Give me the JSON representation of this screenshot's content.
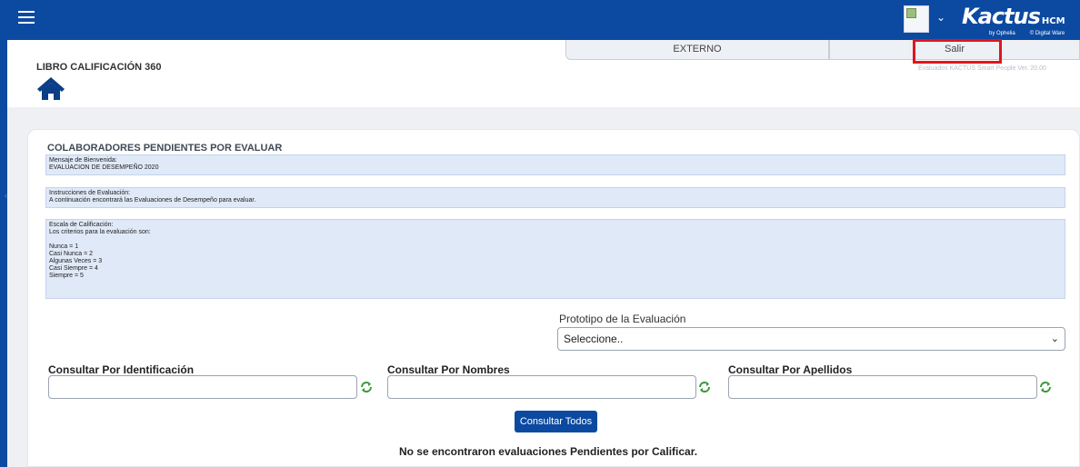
{
  "header": {
    "logo_main": "Kactus",
    "logo_suffix": "HCM",
    "logo_by": "by Ophelia",
    "logo_brand": "© Digital Ware",
    "brand_color": "#0b4aa0"
  },
  "tabs": [
    {
      "label": "EXTERNO"
    },
    {
      "label": "Salir"
    }
  ],
  "version": "Evaluados KACTUS Smart People Ver. 20.00",
  "page": {
    "title": "LIBRO CALIFICACIÓN 360"
  },
  "section": {
    "title": "COLABORADORES PENDIENTES POR EVALUAR",
    "welcome": {
      "label": "Mensaje de Bienvenida:",
      "text": "EVALUACION DE DESEMPEÑO 2020"
    },
    "instructions": {
      "label": "Instrucciones de Evaluación:",
      "text": "A continuación encontrará las Evaluaciones de Desempeño para evaluar."
    },
    "scale": {
      "label": "Escala de Calificación:",
      "intro": "Los criterios para la evaluación son:",
      "items": [
        "Nunca = 1",
        "Casi Nunca = 2",
        "Algunas Veces = 3",
        "Casi Siempre = 4",
        "Siempre = 5"
      ]
    }
  },
  "prototype": {
    "label": "Prototipo de la Evaluación",
    "selected": "Seleccione.."
  },
  "search": {
    "by_id_label": "Consultar Por Identificación",
    "by_names_label": "Consultar Por Nombres",
    "by_lastnames_label": "Consultar Por Apellidos"
  },
  "actions": {
    "consult_all": "Consultar Todos"
  },
  "status": {
    "no_results": "No se encontraron evaluaciones Pendientes por Calificar."
  },
  "icons": {
    "menu": "hamburger-icon",
    "home": "home-icon",
    "refresh": "refresh-icon",
    "dropdown": "chevron-down-icon"
  }
}
